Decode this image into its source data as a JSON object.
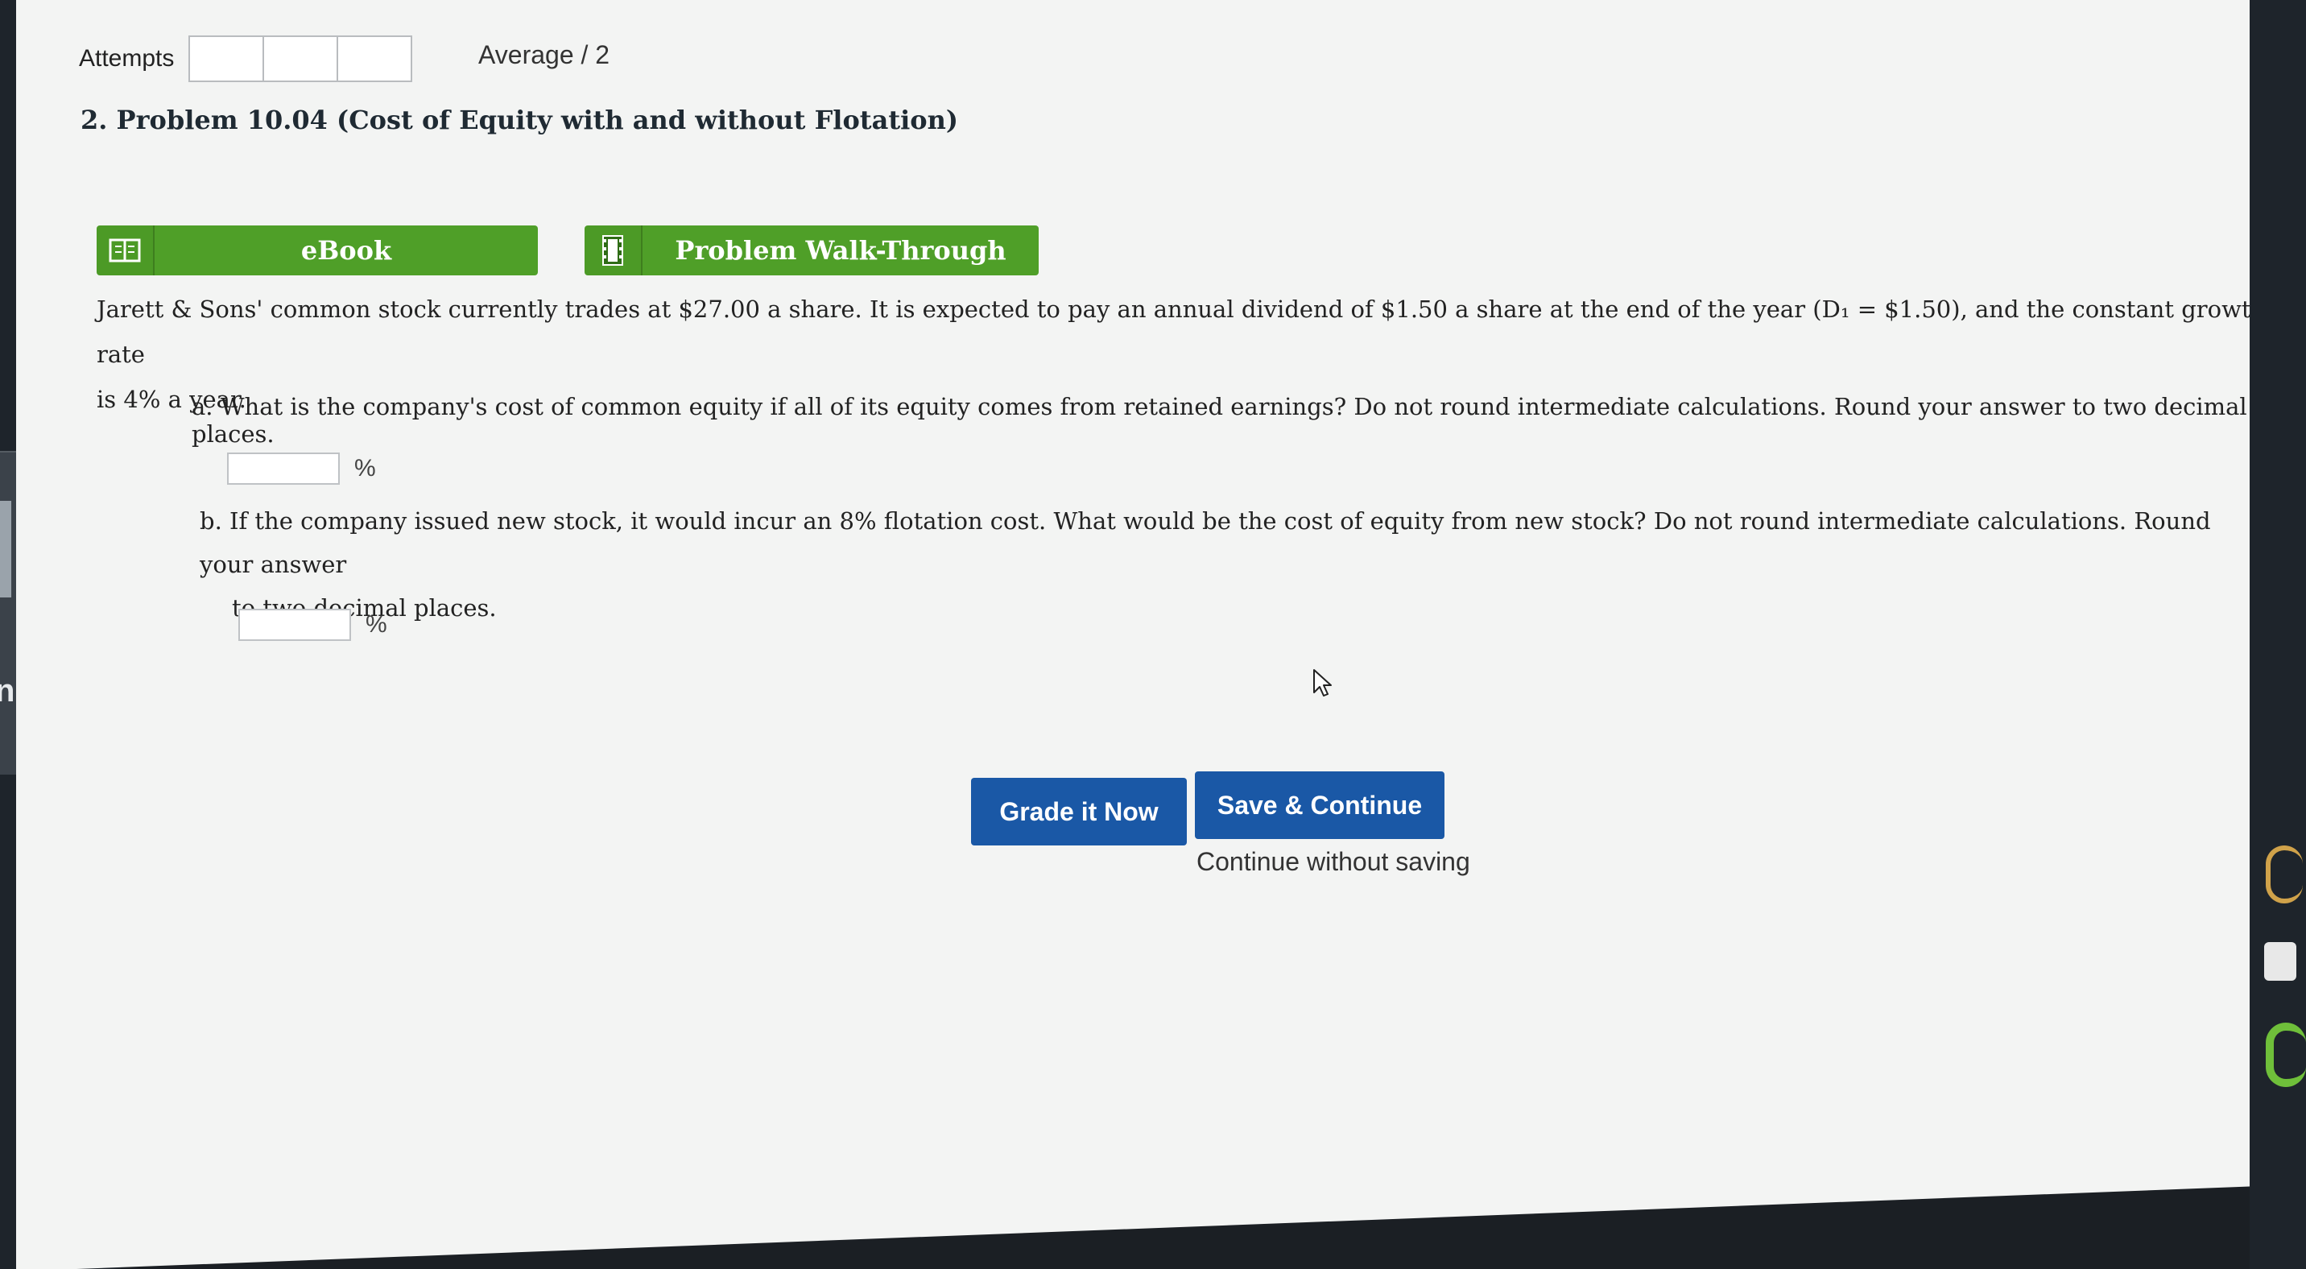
{
  "header": {
    "attempts_label": "Attempts",
    "average_label": "Average / 2"
  },
  "problem": {
    "title": "2. Problem 10.04 (Cost of Equity with and without Flotation)",
    "tools": {
      "ebook_label": "eBook",
      "walkthrough_label": "Problem Walk-Through"
    },
    "intro_line1": "Jarett & Sons' common stock currently trades at $27.00 a share. It is expected to pay an annual dividend of $1.50 a share at the end of the year (D₁ = $1.50), and the constant growth rate",
    "intro_line2": "is 4% a year.",
    "question_a": "a. What is the company's cost of common equity if all of its equity comes from retained earnings? Do not round intermediate calculations. Round your answer to two decimal places.",
    "question_b_line1": "b. If the company issued new stock, it would incur an 8% flotation cost. What would be the cost of equity from new stock? Do not round intermediate calculations. Round your answer",
    "question_b_line2": "to two decimal places.",
    "answer_a": {
      "value": "",
      "unit": "%"
    },
    "answer_b": {
      "value": "",
      "unit": "%"
    }
  },
  "actions": {
    "grade_label": "Grade it Now",
    "save_label": "Save & Continue",
    "continue_label": "Continue without saving"
  },
  "colors": {
    "tool_green": "#4f9f28",
    "primary_blue": "#1a58a6"
  },
  "icons": [
    "book-icon",
    "film-icon",
    "mouse-pointer-icon"
  ],
  "left_strip": {
    "text": "ng"
  }
}
